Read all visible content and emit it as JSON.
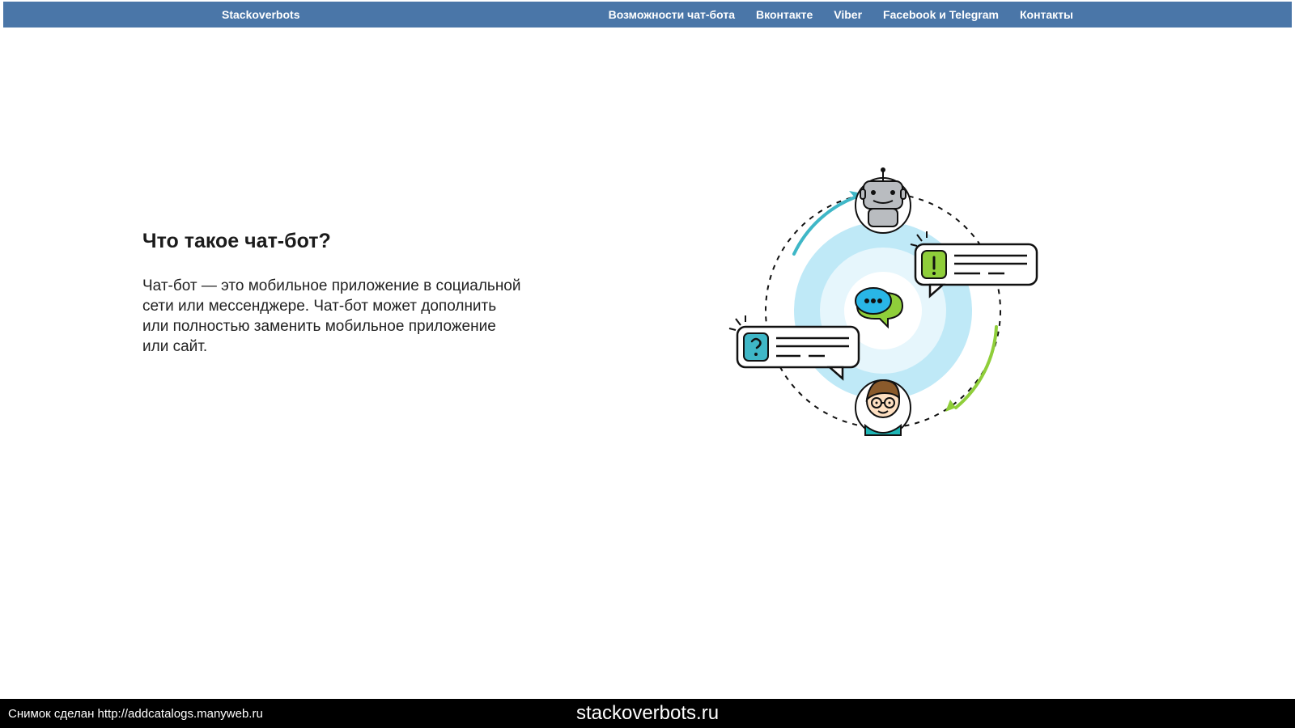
{
  "nav": {
    "brand": "Stackoverbots",
    "items": [
      "Возможности чат-бота",
      "Вконтакте",
      "Viber",
      "Facebook и Telegram",
      "Контакты"
    ]
  },
  "main": {
    "heading": "Что такое чат-бот?",
    "paragraph": "Чат-бот — это мобильное приложение в социальной сети или мессенджере. Чат-бот может дополнить или полностью заменить мобильное приложение или сайт."
  },
  "footer": {
    "left": "Снимок сделан http://addcatalogs.manyweb.ru",
    "center": "stackoverbots.ru"
  }
}
